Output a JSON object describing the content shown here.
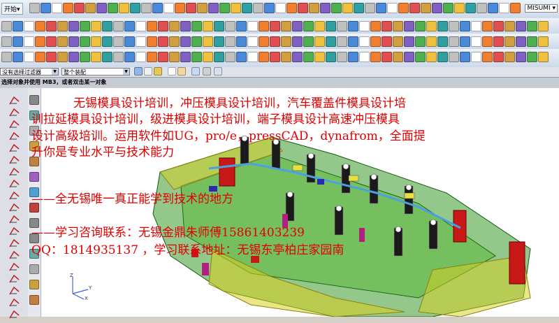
{
  "toolbar": {
    "start_label": "开始▾",
    "brand_label": "MISUMI ▾"
  },
  "filter_bar": {
    "type_filter": "没有选择过滤器",
    "scope_filter": "整个装配"
  },
  "cue_line": "选择对象并使用 MB3，或者双击某一对象",
  "overlay": {
    "line1": "无锡模具设计培训，冲压模具设计培训，汽车覆盖件模具设计培",
    "line2": "训拉延模具设计培训，级进模具设计培训，端子模具设计高速冲压模具",
    "line3": "设计高级培训。运用软件如UG，pro/e，pressCAD，dynafrom，全面提",
    "line4": "升你是专业水平与技术能力",
    "line5": "——全无锡唯一真正能学到技术的地方",
    "line6": "——学习咨询联系：无锡金鼎朱师傅15861403239",
    "line7": "QQ：1814935137 ，学习联系地址：无锡东亭柏庄家园南"
  },
  "colors": {
    "overlay_text": "#e00000",
    "viewport_bg": "#ffffff",
    "model_green": "#3d9a2a",
    "model_red": "#c81818",
    "model_yellow": "#d8d020"
  },
  "axes": {
    "x": "X",
    "y": "Y",
    "z": "Z"
  }
}
